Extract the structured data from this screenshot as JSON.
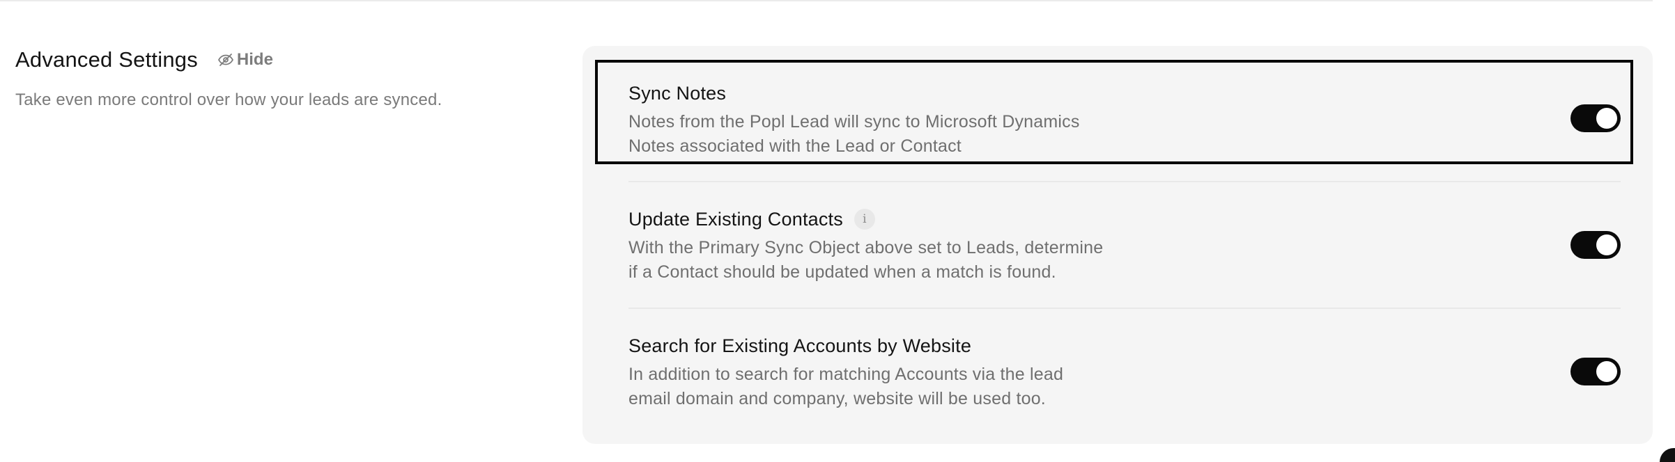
{
  "section": {
    "title": "Advanced Settings",
    "hide_label": "Hide",
    "subtitle": "Take even more control over how your leads are synced."
  },
  "settings": [
    {
      "title": "Sync Notes",
      "desc_line1": "Notes from the Popl Lead will sync to Microsoft Dynamics",
      "desc_line2": "Notes associated with the Lead or Contact",
      "enabled": true,
      "has_info": false
    },
    {
      "title": "Update Existing Contacts",
      "desc_line1": "With the Primary Sync Object above set to Leads, determine",
      "desc_line2": "if a Contact should be updated when a match is found.",
      "enabled": true,
      "has_info": true,
      "info_glyph": "i"
    },
    {
      "title": "Search for Existing Accounts by Website",
      "desc_line1": "In addition to search for matching Accounts via the lead",
      "desc_line2": "email domain and company, website will be used too.",
      "enabled": true,
      "has_info": false
    }
  ],
  "icons": {
    "hide": "eye-slash-icon",
    "info": "info-icon"
  },
  "colors": {
    "toggle_on": "#0a0a0a",
    "card_bg": "#f5f5f5",
    "focus_outline": "#050505"
  }
}
